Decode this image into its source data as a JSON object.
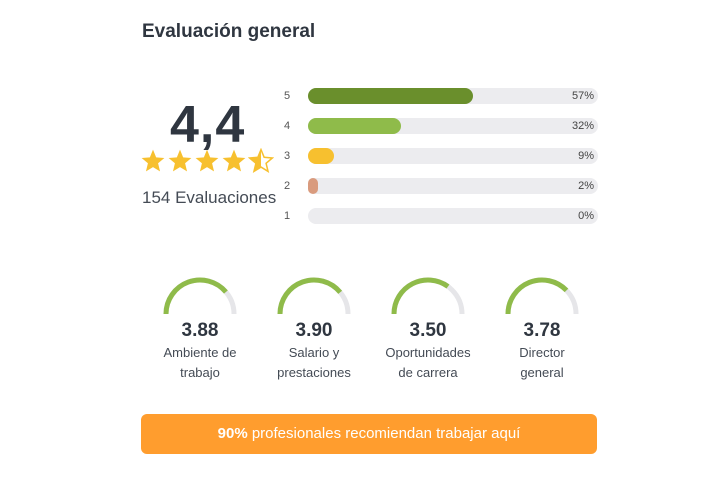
{
  "header": {
    "title": "Evaluación general"
  },
  "summary": {
    "score": "4,4",
    "rating_fraction": 0.88,
    "stars": [
      "full",
      "full",
      "full",
      "full",
      "half"
    ],
    "count_label": "154 Evaluaciones"
  },
  "distribution": [
    {
      "label": "5",
      "percent": 57,
      "percent_label": "57%",
      "color": "#6a8f2c"
    },
    {
      "label": "4",
      "percent": 32,
      "percent_label": "32%",
      "color": "#8fbb4a"
    },
    {
      "label": "3",
      "percent": 9,
      "percent_label": "9%",
      "color": "#f7c02f"
    },
    {
      "label": "2",
      "percent": 2,
      "percent_label": "2%",
      "color": "#d99b7e"
    },
    {
      "label": "1",
      "percent": 0,
      "percent_label": "0%",
      "color": "#cccccc"
    }
  ],
  "categories": [
    {
      "value": "3.88",
      "score": 3.88,
      "label_line1": "Ambiente de",
      "label_line2": "trabajo"
    },
    {
      "value": "3.90",
      "score": 3.9,
      "label_line1": "Salario y",
      "label_line2": "prestaciones"
    },
    {
      "value": "3.50",
      "score": 3.5,
      "label_line1": "Oportunidades",
      "label_line2": "de carrera"
    },
    {
      "value": "3.78",
      "score": 3.78,
      "label_line1": "Director",
      "label_line2": "general"
    }
  ],
  "recommend": {
    "percent": "90%",
    "text": " profesionales recomiendan trabajar aquí"
  },
  "colors": {
    "accent_orange": "#ff9d2e",
    "gauge_green": "#8fbb4a",
    "gauge_track": "#e6e6e9",
    "star_yellow": "#f7c02f"
  }
}
